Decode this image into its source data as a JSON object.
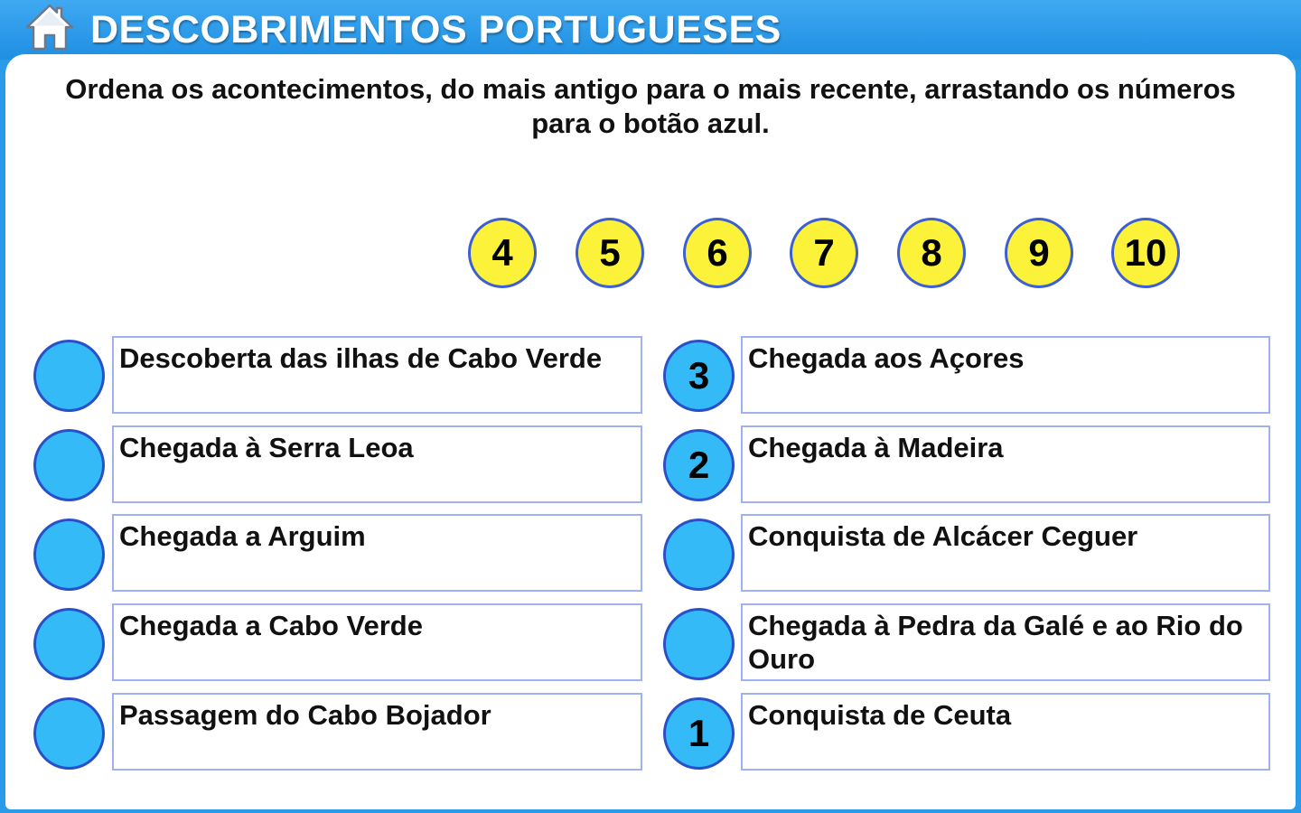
{
  "header": {
    "title": "DESCOBRIMENTOS PORTUGUESES",
    "home_icon": "house-icon",
    "background_color": "#2a9be8"
  },
  "instructions": "Ordena os acontecimentos, do mais antigo para o mais recente, arrastando os números para o botão azul.",
  "tokens": [
    "4",
    "5",
    "6",
    "7",
    "8",
    "9",
    "10"
  ],
  "events": [
    {
      "text": "Descoberta das ilhas de Cabo Verde",
      "slot": ""
    },
    {
      "text": "Chegada aos Açores",
      "slot": "3"
    },
    {
      "text": "Chegada à Serra Leoa",
      "slot": ""
    },
    {
      "text": "Chegada à Madeira",
      "slot": "2"
    },
    {
      "text": "Chegada a Arguim",
      "slot": ""
    },
    {
      "text": "Conquista de Alcácer Ceguer",
      "slot": ""
    },
    {
      "text": "Chegada a Cabo Verde",
      "slot": ""
    },
    {
      "text": "Chegada à Pedra da Galé e ao Rio do Ouro",
      "slot": ""
    },
    {
      "text": "Passagem do Cabo Bojador",
      "slot": ""
    },
    {
      "text": "Conquista de Ceuta",
      "slot": "1"
    }
  ],
  "colors": {
    "token_fill": "#fdf23a",
    "token_border": "#3d5fd3",
    "slot_fill": "#34baf7",
    "slot_border": "#2a50c9",
    "box_border": "#9fb1f0"
  }
}
